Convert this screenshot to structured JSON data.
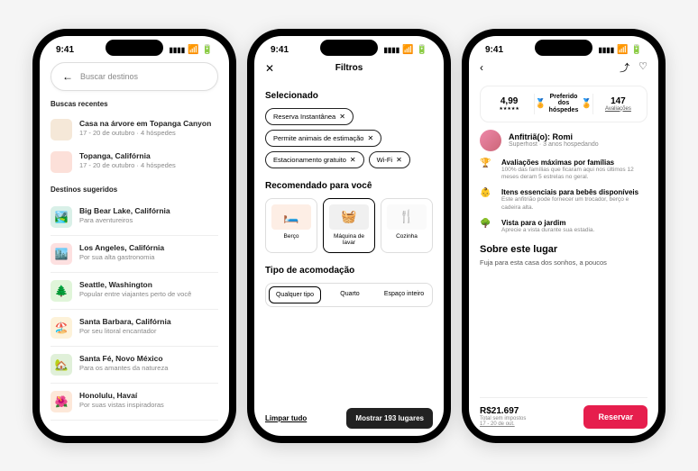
{
  "status_time": "9:41",
  "phone1": {
    "search_placeholder": "Buscar destinos",
    "recent_header": "Buscas recentes",
    "recent": [
      {
        "title": "Casa na árvore em Topanga Canyon",
        "sub": "17 - 20 de outubro · 4 hóspedes",
        "bg": "#f5e8d8"
      },
      {
        "title": "Topanga, Califórnia",
        "sub": "17 - 20 de outubro · 4 hóspedes",
        "bg": "#fce0d9"
      }
    ],
    "suggested_header": "Destinos sugeridos",
    "suggested": [
      {
        "title": "Big Bear Lake, Califórnia",
        "sub": "Para aventureiros",
        "bg": "#d9f0e8",
        "icon": "🏞️"
      },
      {
        "title": "Los Angeles, Califórnia",
        "sub": "Por sua alta gastronomia",
        "bg": "#fde0e0",
        "icon": "🏙️"
      },
      {
        "title": "Seattle, Washington",
        "sub": "Popular entre viajantes perto de você",
        "bg": "#e0f5d9",
        "icon": "🌲"
      },
      {
        "title": "Santa Barbara, Califórnia",
        "sub": "Por seu litoral encantador",
        "bg": "#fdf2d9",
        "icon": "🏖️"
      },
      {
        "title": "Santa Fé, Novo México",
        "sub": "Para os amantes da natureza",
        "bg": "#e0f0d9",
        "icon": "🏡"
      },
      {
        "title": "Honolulu, Havaí",
        "sub": "Por suas vistas inspiradoras",
        "bg": "#fde8d9",
        "icon": "🌺"
      }
    ]
  },
  "phone2": {
    "title": "Filtros",
    "selected_header": "Selecionado",
    "chips": [
      "Reserva Instantânea",
      "Permite animais de estimação",
      "Estacionamento gratuito",
      "Wi-Fi"
    ],
    "rec_header": "Recomendado para você",
    "rec": [
      {
        "label": "Berço",
        "icon": "🛏️",
        "bg": "#fdeee5"
      },
      {
        "label": "Máquina de lavar",
        "icon": "🧺",
        "bg": "#f0f0f0"
      },
      {
        "label": "Cozinha",
        "icon": "🍴",
        "bg": "#fafafa"
      }
    ],
    "type_header": "Tipo de acomodação",
    "types": [
      "Qualquer tipo",
      "Quarto",
      "Espaço inteiro"
    ],
    "clear": "Limpar tudo",
    "show": "Mostrar 193 lugares"
  },
  "phone3": {
    "rating": "4,99",
    "preferred": "Preferido dos hóspedes",
    "reviews_count": "147",
    "reviews_label": "Avaliações",
    "host_name": "Anfitriã(o): Romi",
    "host_sub": "Superhost · 3 anos hospedando",
    "features": [
      {
        "icon": "🏆",
        "title": "Avaliações máximas por famílias",
        "desc": "100% das famílias que ficaram aqui nos últimos 12 meses deram 5 estrelas no geral."
      },
      {
        "icon": "👶",
        "title": "Itens essenciais para bebês disponíveis",
        "desc": "Este anfitrião pode fornecer um trocador, berço e cadeira alta."
      },
      {
        "icon": "🌳",
        "title": "Vista para o jardim",
        "desc": "Aprecie a vista durante sua estadia."
      }
    ],
    "about_header": "Sobre este lugar",
    "about_text": "Fuja para esta casa dos sonhos, a poucos",
    "price": "R$21.697",
    "price_sub1": "Total sem impostos",
    "price_sub2": "17 - 20 de out.",
    "book": "Reservar"
  }
}
